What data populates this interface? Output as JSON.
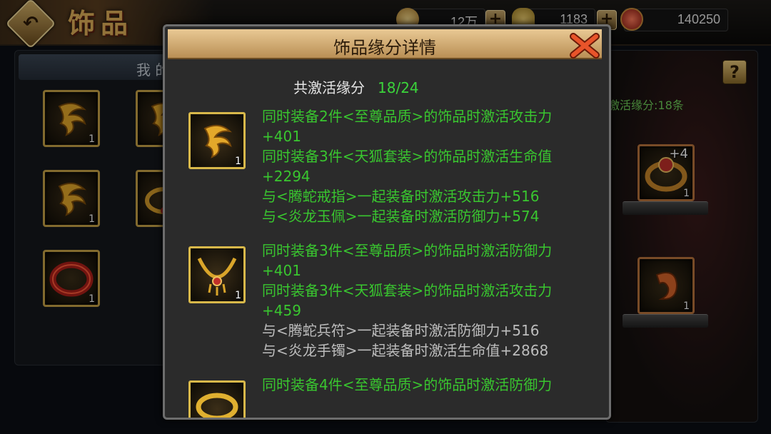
{
  "header": {
    "title": "饰品",
    "resources": [
      {
        "name": "coin",
        "value": "12万"
      },
      {
        "name": "ingot",
        "value": "1183"
      },
      {
        "name": "gem",
        "value": "140250"
      }
    ]
  },
  "left_panel": {
    "tab_label": "我 的",
    "items": [
      {
        "icon": "fox-pendant-icon",
        "count": "1"
      },
      {
        "icon": "fox-pendant-icon",
        "count": ""
      },
      {
        "icon": "fox-pendant-icon",
        "count": "1"
      },
      {
        "icon": "ring-icon",
        "count": ""
      },
      {
        "icon": "red-bracelet-icon",
        "count": "1"
      }
    ]
  },
  "right_panel": {
    "label": "激活缘分:18条",
    "equipped": [
      {
        "icon": "ruby-ring-icon",
        "count": "1",
        "level": "+4"
      },
      {
        "icon": "dragon-jade-icon",
        "count": "1"
      }
    ]
  },
  "dialog": {
    "title": "饰品缘分详情",
    "summary_label": "共激活缘分",
    "summary_value": "18/24",
    "entries": [
      {
        "icon": "fox-pendant-icon",
        "count": "1",
        "lines": [
          {
            "text": "同时装备2件<至尊品质>的饰品时激活攻击力",
            "active": true
          },
          {
            "text": "+401",
            "active": true
          },
          {
            "text": "同时装备3件<天狐套装>的饰品时激活生命值",
            "active": true
          },
          {
            "text": "+2294",
            "active": true
          },
          {
            "text": "与<腾蛇戒指>一起装备时激活攻击力+516",
            "active": true
          },
          {
            "text": "与<炎龙玉佩>一起装备时激活防御力+574",
            "active": true
          }
        ]
      },
      {
        "icon": "gold-necklace-icon",
        "count": "1",
        "lines": [
          {
            "text": "同时装备3件<至尊品质>的饰品时激活防御力",
            "active": true
          },
          {
            "text": "+401",
            "active": true
          },
          {
            "text": "同时装备3件<天狐套装>的饰品时激活攻击力",
            "active": true
          },
          {
            "text": "+459",
            "active": true
          },
          {
            "text": "与<腾蛇兵符>一起装备时激活防御力+516",
            "active": false
          },
          {
            "text": "与<炎龙手镯>一起装备时激活生命值+2868",
            "active": false
          }
        ]
      },
      {
        "icon": "gold-ring-icon",
        "count": "",
        "lines": [
          {
            "text": "同时装备4件<至尊品质>的饰品时激活防御力",
            "active": true
          }
        ]
      }
    ]
  },
  "colors": {
    "active_text": "#39c62f",
    "inactive_text": "#bdbdbd",
    "gold_border": "#d8b84a"
  }
}
